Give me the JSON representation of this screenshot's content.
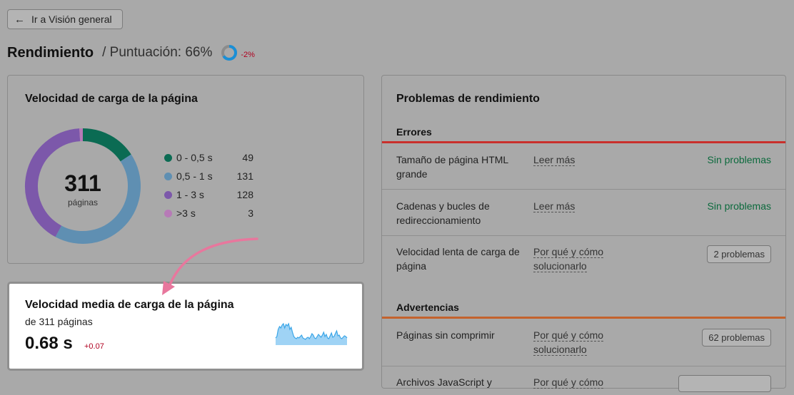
{
  "nav": {
    "back_label": "Ir a Visión general"
  },
  "header": {
    "title": "Rendimiento",
    "score_label": "/ Puntuación: 66%",
    "score_percent": 66,
    "score_delta": "-2%"
  },
  "speed_card": {
    "title": "Velocidad de carga de la página",
    "total": "311",
    "total_label": "páginas",
    "legend": [
      {
        "label": "0 - 0,5 s",
        "count": "49",
        "color": "#0b6b53"
      },
      {
        "label": "0,5 - 1 s",
        "count": "131",
        "color": "#5f8fb2"
      },
      {
        "label": "1 - 3 s",
        "count": "128",
        "color": "#7c58aa"
      },
      {
        "label": ">3 s",
        "count": "3",
        "color": "#b77ab7"
      }
    ]
  },
  "avg_card": {
    "title": "Velocidad media de carga de la página",
    "subtitle": "de 311 páginas",
    "value": "0.68 s",
    "delta": "+0.07"
  },
  "issues_card": {
    "title": "Problemas de rendimiento",
    "errors": {
      "title": "Errores",
      "color": "#c9302c",
      "rows": [
        {
          "name": "Tamaño de página HTML grande",
          "link": "Leer más",
          "status": "Sin problemas"
        },
        {
          "name": "Cadenas y bucles de redireccionamiento",
          "link": "Leer más",
          "status": "Sin problemas"
        },
        {
          "name": "Velocidad lenta de carga de página",
          "link": "Por qué y cómo solucionarlo",
          "count": "2 problemas"
        }
      ]
    },
    "warnings": {
      "title": "Advertencias",
      "color": "#c4622d",
      "rows": [
        {
          "name": "Páginas sin comprimir",
          "link": "Por qué y cómo solucionarlo",
          "count": "62 problemas"
        },
        {
          "name": "Archivos JavaScript y",
          "link": "Por qué y cómo"
        }
      ]
    }
  },
  "colors": {
    "accent_pink": "#e8779d",
    "ok_green": "#0c6a3d",
    "delta_red": "#b00020",
    "score_ring": "#1a8fd6",
    "sparkline": "#3aa6e8"
  }
}
